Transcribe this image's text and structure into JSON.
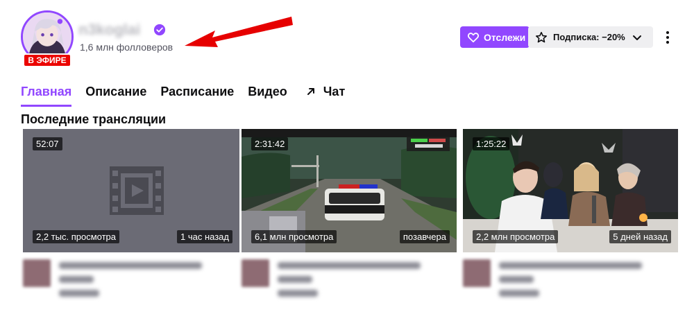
{
  "channel": {
    "name": "n3koglai",
    "followers": "1,6 млн фолловеров",
    "live_badge": "В ЭФИРЕ"
  },
  "actions": {
    "follow_label": "Отслежи",
    "subscribe_label": "Подписка: −20%"
  },
  "tabs": [
    {
      "label": "Главная"
    },
    {
      "label": "Описание"
    },
    {
      "label": "Расписание"
    },
    {
      "label": "Видео"
    },
    {
      "label": "Чат"
    }
  ],
  "section": {
    "title": "Последние трансляции"
  },
  "videos": [
    {
      "duration": "52:07",
      "views": "2,2 тыс. просмотра",
      "ago": "1 час назад"
    },
    {
      "duration": "2:31:42",
      "views": "6,1 млн просмотра",
      "ago": "позавчера"
    },
    {
      "duration": "1:25:22",
      "views": "2,2 млн просмотра",
      "ago": "5 дней назад"
    }
  ],
  "colors": {
    "accent": "#9147ff",
    "live": "#eb0400",
    "annotation_arrow": "#e60000"
  }
}
